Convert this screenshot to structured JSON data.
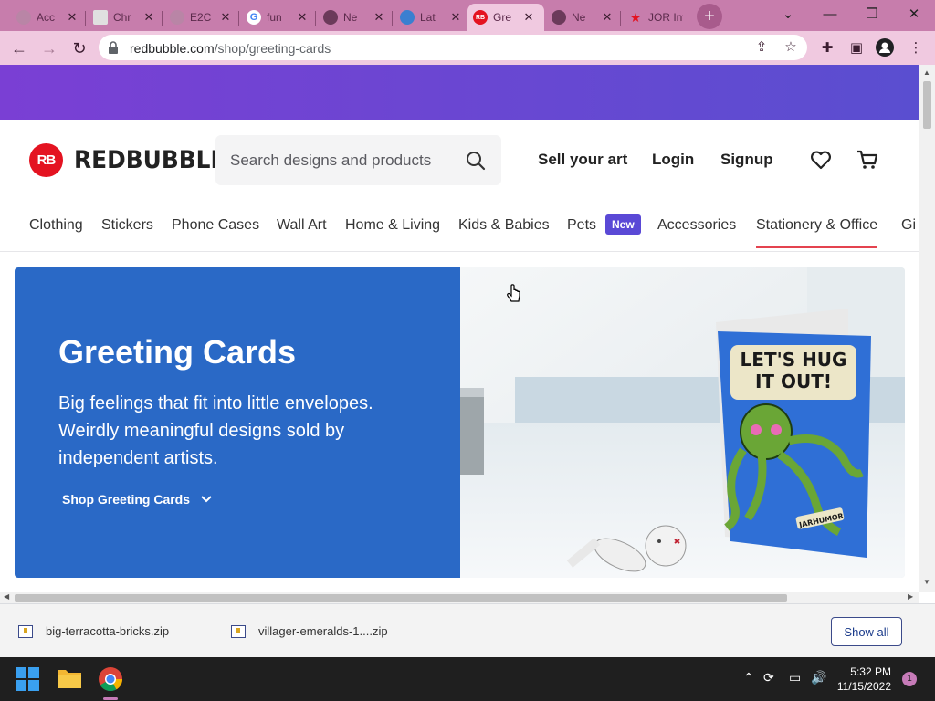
{
  "browser": {
    "tabs": [
      {
        "title": "Acc",
        "fav_color": "#b985a6",
        "active": false
      },
      {
        "title": "Chr",
        "fav_color": "#e0e0e0",
        "active": false
      },
      {
        "title": "E2C",
        "fav_color": "#b985a6",
        "active": false
      },
      {
        "title": "fun",
        "fav_color": "#ffffff",
        "active": false
      },
      {
        "title": "Ne",
        "fav_color": "#6b3a5a",
        "active": false
      },
      {
        "title": "Lat",
        "fav_color": "#3a7fd0",
        "active": false
      },
      {
        "title": "Gre",
        "fav_color": "#e41321",
        "active": true
      },
      {
        "title": "Ne",
        "fav_color": "#6b3a5a",
        "active": false
      },
      {
        "title": "JOR Int",
        "fav_color": "#e41321",
        "active": false
      }
    ],
    "url_domain": "redbubble.com",
    "url_path": "/shop/greeting-cards"
  },
  "header": {
    "logo_mark": "RB",
    "logo_text": "REDBUBBLE",
    "search_placeholder": "Search designs and products",
    "links": [
      "Sell your art",
      "Login",
      "Signup"
    ]
  },
  "nav": {
    "categories": [
      "Clothing",
      "Stickers",
      "Phone Cases",
      "Wall Art",
      "Home & Living",
      "Kids & Babies",
      "Pets",
      "Accessories",
      "Stationery & Office",
      "Gi"
    ],
    "new_badge": "New",
    "active": "Stationery & Office"
  },
  "hero": {
    "title": "Greeting Cards",
    "subtitle": "Big feelings that fit into little envelopes. Weirdly meaningful designs sold by independent artists.",
    "cta": "Shop Greeting Cards",
    "card_text": [
      "LET'S HUG",
      "IT OUT!"
    ],
    "card_signature": "JARHUMOR",
    "bg_color": "#2a69c6"
  },
  "downloads": {
    "items": [
      "big-terracotta-bricks.zip",
      "villager-emeralds-1....zip"
    ],
    "show_all": "Show all"
  },
  "taskbar": {
    "time": "5:32 PM",
    "date": "11/15/2022",
    "notifications": "1"
  },
  "colors": {
    "brand_red": "#e41321",
    "tab_strip": "#c77dac",
    "toolbar": "#f0c9e0"
  }
}
